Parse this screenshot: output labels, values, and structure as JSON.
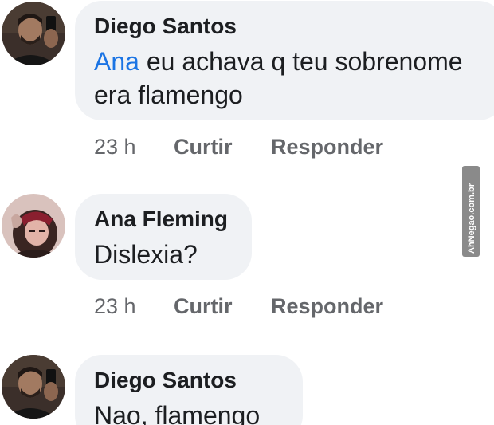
{
  "comments": [
    {
      "author": "Diego Santos",
      "mention": "Ana",
      "text_line1": " eu achava q teu sobrenome",
      "text_line2": "era flamengo",
      "time": "23 h",
      "like_label": "Curtir",
      "reply_label": "Responder",
      "avatar_icon": "man-selfie-avatar"
    },
    {
      "author": "Ana Fleming",
      "text_line1": "Dislexia?",
      "time": "23 h",
      "like_label": "Curtir",
      "reply_label": "Responder",
      "avatar_icon": "woman-avatar"
    },
    {
      "author": "Diego Santos",
      "text_line1": "Nao, flamengo",
      "avatar_icon": "man-selfie-avatar"
    }
  ],
  "watermark": {
    "text": "AhNegao.com.br"
  },
  "colors": {
    "bubble": "#f0f2f5",
    "mention": "#1b74e4",
    "meta_text": "#65676b",
    "author_text": "#1c1e21"
  }
}
